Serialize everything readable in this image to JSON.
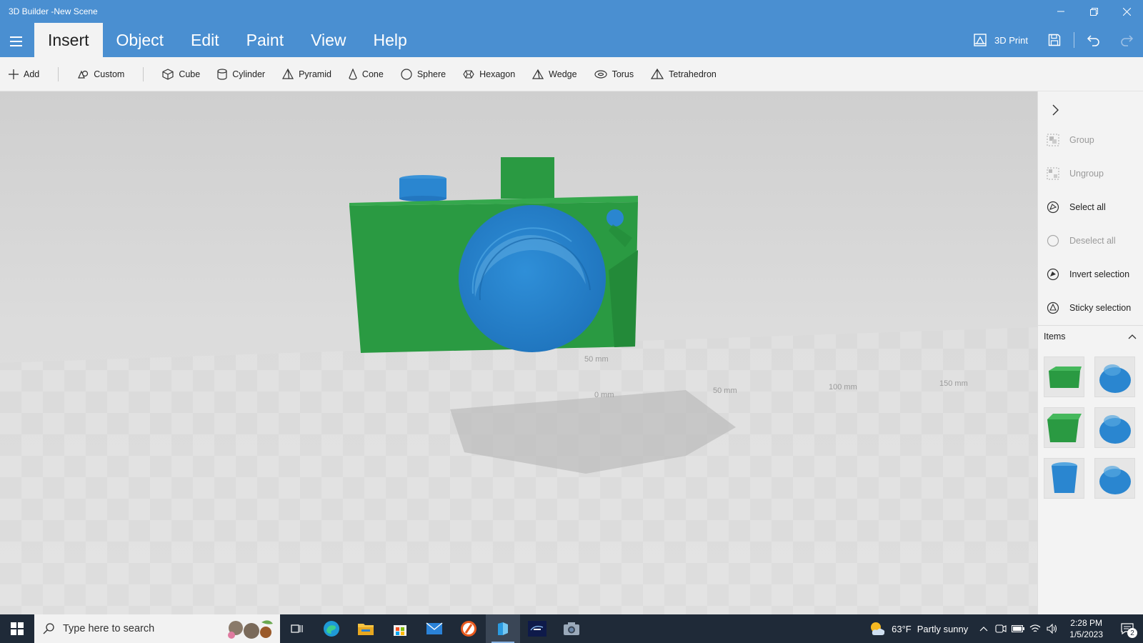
{
  "window": {
    "title": "3D Builder -New Scene",
    "minimize_icon": "minimize-icon",
    "restore_icon": "restore-icon",
    "close_icon": "close-icon"
  },
  "ribbon": {
    "tabs": [
      {
        "label": "Insert",
        "active": true
      },
      {
        "label": "Object",
        "active": false
      },
      {
        "label": "Edit",
        "active": false
      },
      {
        "label": "Paint",
        "active": false
      },
      {
        "label": "View",
        "active": false
      },
      {
        "label": "Help",
        "active": false
      }
    ],
    "print_label": "3D Print",
    "accent_color": "#4a8fd1"
  },
  "toolbar": {
    "add": "Add",
    "custom": "Custom",
    "shapes": [
      "Cube",
      "Cylinder",
      "Pyramid",
      "Cone",
      "Sphere",
      "Hexagon",
      "Wedge",
      "Torus",
      "Tetrahedron"
    ]
  },
  "viewport": {
    "ruler_labels": [
      "50 mm",
      "0 mm",
      "50 mm",
      "100 mm",
      "150 mm"
    ],
    "model_colors": {
      "body": "#2a9a42",
      "lens": "#2a86d0"
    }
  },
  "panel": {
    "actions": [
      {
        "label": "Group",
        "enabled": false
      },
      {
        "label": "Ungroup",
        "enabled": false
      },
      {
        "label": "Select all",
        "enabled": true
      },
      {
        "label": "Deselect all",
        "enabled": false
      },
      {
        "label": "Invert selection",
        "enabled": true
      },
      {
        "label": "Sticky selection",
        "enabled": true
      }
    ],
    "items_label": "Items"
  },
  "taskbar": {
    "search_placeholder": "Type here to search",
    "weather_temp": "63°F",
    "weather_desc": "Partly sunny",
    "time": "2:28 PM",
    "date": "1/5/2023",
    "notifications": "2"
  }
}
